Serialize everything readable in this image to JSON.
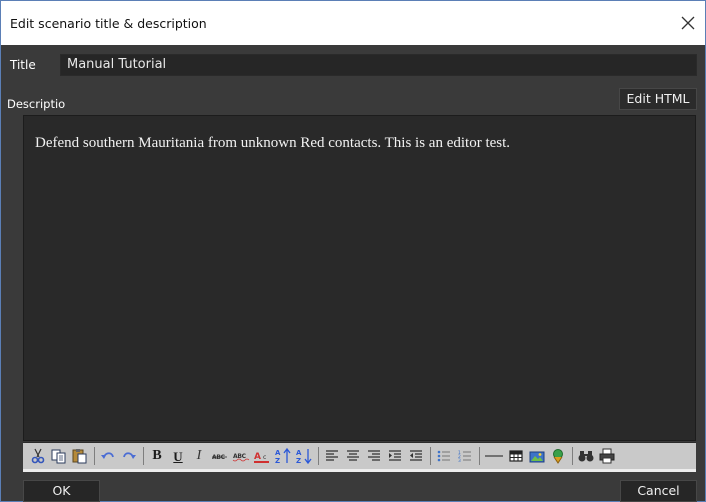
{
  "window": {
    "title": "Edit scenario title & description",
    "close_icon": "close-icon"
  },
  "form": {
    "title_label": "Title",
    "title_value": "Manual Tutorial",
    "description_label": "Descriptio",
    "edit_html_label": "Edit HTML",
    "description_text": "Defend southern Mauritania from unknown Red contacts. This is an editor test."
  },
  "toolbar": {
    "groups": [
      [
        "cut-icon",
        "copy-icon",
        "paste-icon"
      ],
      [
        "undo-icon",
        "redo-icon"
      ],
      [
        "bold-icon",
        "underline-icon",
        "italic-icon",
        "strikethrough-icon",
        "spellcheck-icon",
        "font-color-icon",
        "sort-ascending-icon",
        "sort-descending-icon"
      ],
      [
        "align-left-icon",
        "align-center-icon",
        "align-right-icon",
        "indent-icon",
        "outdent-icon"
      ],
      [
        "bullet-list-icon",
        "numbered-list-icon"
      ],
      [
        "horizontal-rule-icon",
        "table-icon",
        "image-icon",
        "link-icon"
      ],
      [
        "find-icon",
        "print-icon"
      ]
    ],
    "colors": {
      "cut": "#3355bb",
      "copy": "#2b3b5c",
      "paste": "#2b3b5c",
      "undo": "#4a6cd4",
      "redo": "#4a6cd4",
      "font_color": "#d03030",
      "sort": "#2a58d8",
      "image": "#3d73c9",
      "link": "#d99f1f"
    }
  },
  "buttons": {
    "ok_label": "OK",
    "cancel_label": "Cancel"
  }
}
